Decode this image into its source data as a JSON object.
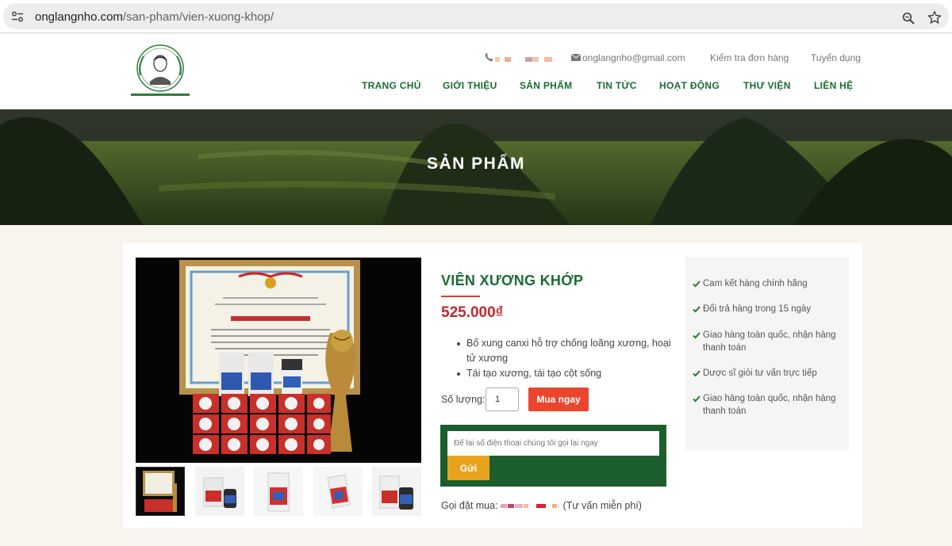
{
  "browser": {
    "url_domain": "onglangnho.com",
    "url_path": "/san-pham/vien-xuong-khop/",
    "icons": [
      "tune-icon",
      "zoom-icon",
      "star-icon"
    ]
  },
  "header": {
    "email": "onglangnho@gmail.com",
    "order_check": "Kiểm tra đơn hàng",
    "recruitment": "Tuyển dụng",
    "nav": [
      "TRANG CHỦ",
      "GIỚI THIỆU",
      "SẢN PHẨM",
      "TIN TỨC",
      "HOẠT ĐỘNG",
      "THƯ VIỆN",
      "LIÊN HỆ"
    ],
    "brand_green": "#1a6b34"
  },
  "banner": {
    "title": "SẢN PHẨM"
  },
  "product": {
    "name": "VIÊN XƯƠNG KHỚP",
    "price": "525.000₫",
    "bullets": [
      "Bổ xung canxi hỗ trợ chống loãng xương, hoại tử xương",
      "Tái tạo xương, tái tạo cột sống"
    ],
    "quantity_label": "Số lượng:",
    "quantity_value": "1",
    "buy_label": "Mua ngay",
    "callback_placeholder": "Để lại số điện thoại chúng tôi gọi lại ngay",
    "send_label": "Gửi",
    "call_prefix": "Gọi đặt mua:",
    "call_suffix": "(Tư vấn miễn phí)",
    "price_color": "#c0282d",
    "accent_red": "#e8472e",
    "accent_gold": "#e8a31e"
  },
  "benefits": [
    "Cam kết hàng chính hãng",
    "Đổi trả hàng trong 15 ngày",
    "Giao hàng toàn quốc, nhận hàng thanh toán",
    "Dược sĩ giỏi tư vấn trực tiếp",
    "Giao hàng toàn quốc, nhận hàng thanh toán"
  ]
}
